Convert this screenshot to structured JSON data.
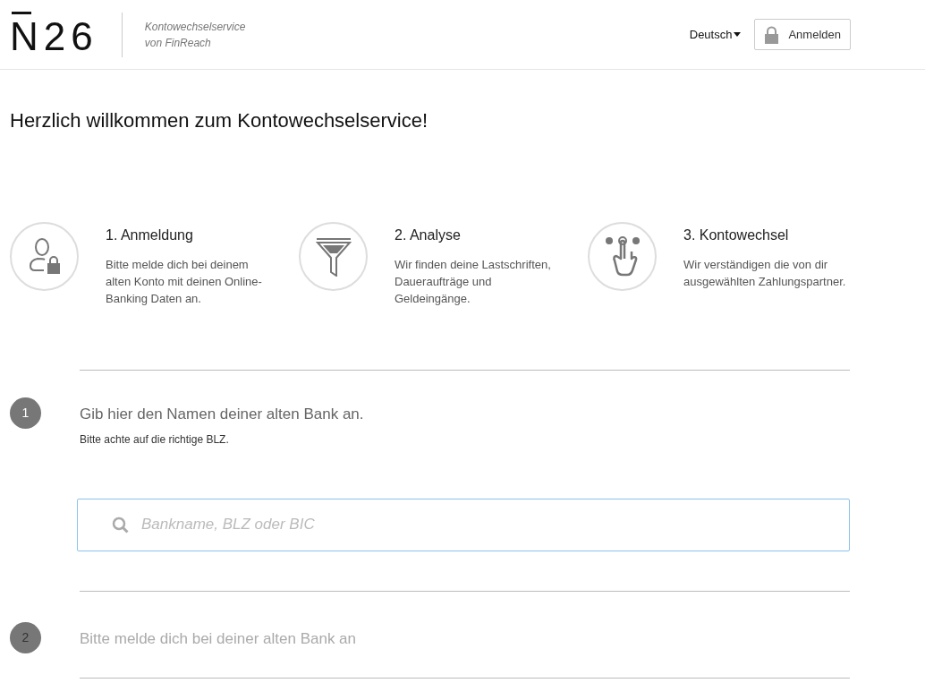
{
  "header": {
    "logo": "N26",
    "tagline": [
      "Kontowechselservice",
      "von FinReach"
    ],
    "language": "Deutsch",
    "login_button": "Anmelden"
  },
  "title": "Herzlich willkommen zum Kontowechselservice!",
  "features": [
    {
      "kind": "login",
      "title": "1. Anmeldung",
      "text": "Bitte melde dich bei deinem alten Konto mit deinen Online-Banking Daten an."
    },
    {
      "kind": "filter",
      "title": "2. Analyse",
      "text": "Wir finden deine Lastschriften, Daueraufträge und Geldeingänge."
    },
    {
      "kind": "switch",
      "title": "3. Kontowechsel",
      "text": "Wir verständigen die von dir ausgewählten Zahlungspartner."
    }
  ],
  "steps": [
    {
      "number": "1",
      "title": "Gib hier den Namen deiner alten Bank an.",
      "hint": "Bitte achte auf die richtige BLZ.",
      "active": true,
      "search": {
        "placeholder": "Bankname, BLZ oder BIC"
      }
    },
    {
      "number": "2",
      "title": "Bitte melde dich bei deiner alten Bank an",
      "active": false
    }
  ]
}
